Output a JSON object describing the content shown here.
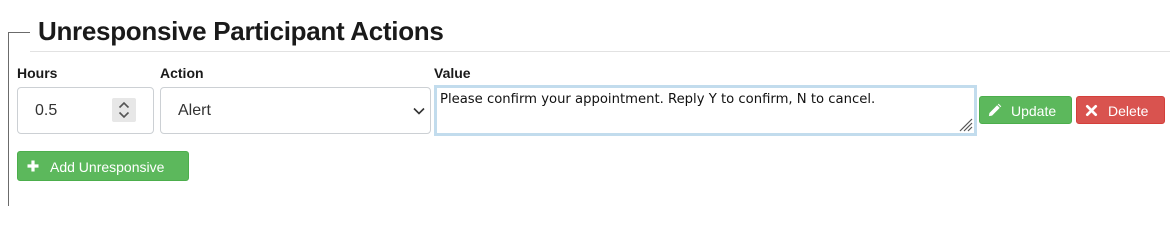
{
  "section": {
    "title": "Unresponsive Participant Actions"
  },
  "columns": {
    "hours": "Hours",
    "action": "Action",
    "value": "Value"
  },
  "row": {
    "hours_value": "0.5",
    "action_selected": "Alert",
    "value_text": "Please confirm your appointment. Reply Y to confirm, N to cancel."
  },
  "buttons": {
    "update": "Update",
    "delete": "Delete",
    "add_unresponsive": "Add Unresponsive"
  },
  "icons": {
    "update": "pencil-icon",
    "delete": "times-icon",
    "add": "plus-icon",
    "spinner": "spinner-arrows-icon",
    "select": "chevron-down-icon"
  },
  "colors": {
    "success": "#5cb85c",
    "danger": "#d9534f",
    "focus_border": "#c2dced"
  }
}
